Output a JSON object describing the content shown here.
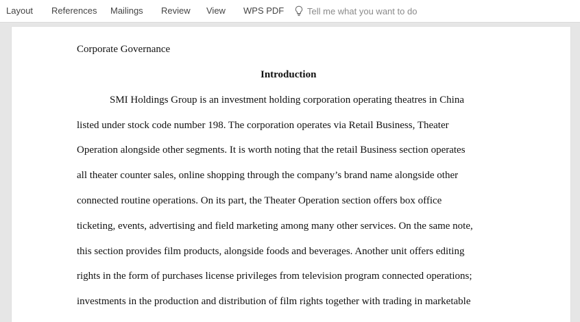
{
  "ribbon": {
    "tabs": [
      {
        "label": "Layout"
      },
      {
        "label": "References"
      },
      {
        "label": "Mailings"
      },
      {
        "label": "Review"
      },
      {
        "label": "View"
      },
      {
        "label": "WPS PDF"
      }
    ],
    "tell_me_placeholder": "Tell me what you want to do",
    "tell_me_icon": "lightbulb-icon"
  },
  "document": {
    "header_text": "Corporate Governance",
    "title": "Introduction",
    "lines": [
      "SMI Holdings Group is an investment holding corporation operating theatres in China",
      "listed under stock code number 198. The corporation operates via Retail Business, Theater",
      "Operation alongside other segments. It is worth noting that the retail Business section operates",
      "all theater counter sales, online shopping through the company’s brand name alongside other",
      "connected routine operations. On its part, the Theater Operation section offers box office",
      "ticketing, events, advertising and field marketing among many other services. On the same note,",
      "this section provides film products, alongside foods and beverages. Another unit offers editing",
      "rights in the form of purchases license privileges from television program connected operations;",
      "investments in the production and distribution of film rights together with trading in marketable"
    ]
  },
  "colors": {
    "ribbon_bg": "#ffffff",
    "workspace_bg": "#e6e6e6",
    "page_bg": "#ffffff",
    "tab_text": "#444444",
    "placeholder_text": "#8a8a8a"
  }
}
